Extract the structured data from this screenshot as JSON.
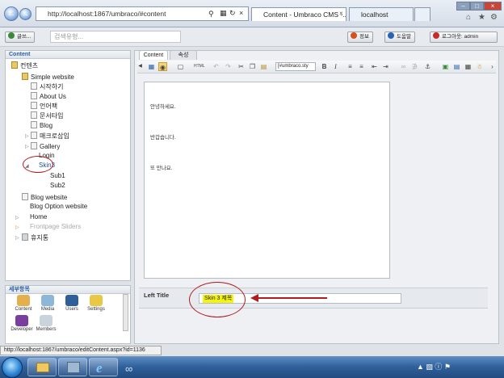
{
  "browser": {
    "url": "http://localhost:1867/umbraco/#content",
    "tabs": [
      {
        "label": "Content - Umbraco CMS -..."
      },
      {
        "label": "localhost"
      }
    ]
  },
  "topbar": {
    "left_button": "글쓰...",
    "search_placeholder": "검색유형...",
    "help_button": "정보",
    "manual_button": "도움말",
    "logout_button": "로그아웃: admin"
  },
  "tree": {
    "header": "Content",
    "root": "컨텐츠",
    "simple_website": "Simple website",
    "children": [
      "시작하기",
      "About Us",
      "언어팩",
      "문서타입",
      "Blog",
      "매크로삽입",
      "Gallery",
      "Login",
      "Skin3"
    ],
    "skin3_children": [
      "Sub1",
      "Sub2"
    ],
    "others": [
      "Blog website",
      "Blog Option website",
      "Home",
      "Frontpage Sliders",
      "휴지통"
    ]
  },
  "sections": {
    "header": "세부항목",
    "items": [
      "Content",
      "Media",
      "Users",
      "Settings",
      "Developer",
      "Members"
    ]
  },
  "editor": {
    "tabs": [
      "Content",
      "속성"
    ],
    "style_select": "[#umbraco.sty",
    "body_lines": [
      "안녕하세요.",
      "반갑습니다.",
      "또 만나요."
    ],
    "field_label": "Left Title",
    "field_value": "Skin 3 제목"
  },
  "status": {
    "text": "http://localhost:1867/umbraco/editContent.aspx?id=1136"
  }
}
